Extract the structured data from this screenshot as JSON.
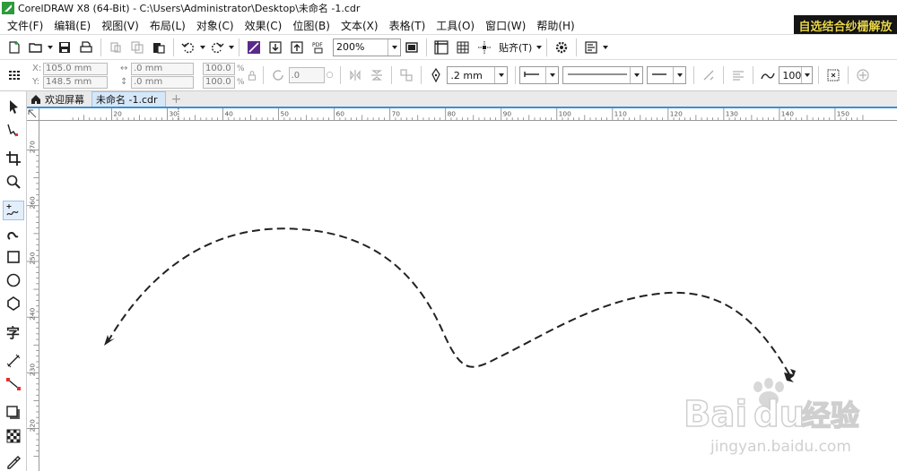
{
  "window": {
    "title": "CorelDRAW X8 (64-Bit) - C:\\Users\\Administrator\\Desktop\\未命名 -1.cdr",
    "banner": "自选结合纱栅解放"
  },
  "menu": [
    {
      "label": "文件(F)"
    },
    {
      "label": "编辑(E)"
    },
    {
      "label": "视图(V)"
    },
    {
      "label": "布局(L)"
    },
    {
      "label": "对象(C)"
    },
    {
      "label": "效果(C)"
    },
    {
      "label": "位图(B)"
    },
    {
      "label": "文本(X)"
    },
    {
      "label": "表格(T)"
    },
    {
      "label": "工具(O)"
    },
    {
      "label": "窗口(W)"
    },
    {
      "label": "帮助(H)"
    }
  ],
  "toolbar": {
    "zoom": "200%",
    "snap_label": "贴齐(T)",
    "pdf_label": "PDF"
  },
  "property_bar": {
    "x_label": "X:",
    "y_label": "Y:",
    "x_value": "105.0 mm",
    "y_value": "148.5 mm",
    "w_value": ".0 mm",
    "h_value": ".0 mm",
    "sx_value": "100.0",
    "sy_value": "100.0",
    "pct": "%",
    "rotation": ".0",
    "outline_width": ".2 mm",
    "smooth_value": "100"
  },
  "tabs": [
    {
      "label": "欢迎屏幕"
    },
    {
      "label": "未命名 -1.cdr"
    }
  ],
  "ruler_h": [
    "20",
    "30",
    "40",
    "50",
    "60",
    "70",
    "80",
    "90",
    "100",
    "110",
    "120",
    "130",
    "140",
    "150"
  ],
  "ruler_v": [
    "270",
    "260",
    "250",
    "240",
    "230",
    "220"
  ],
  "watermark": {
    "brand_baidu": "Bai",
    "brand_du": "du",
    "brand_cn": "经验",
    "url": "jingyan.baidu.com"
  }
}
